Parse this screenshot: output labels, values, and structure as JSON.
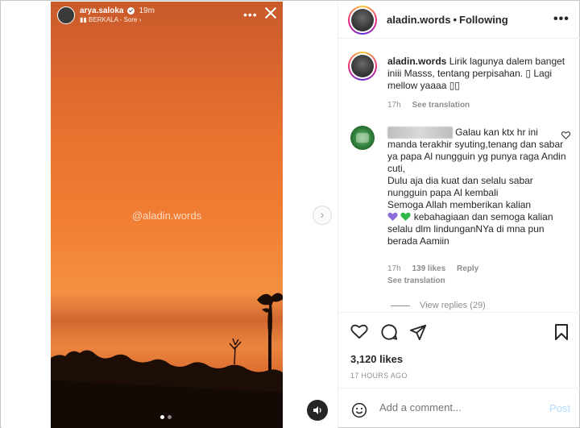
{
  "story": {
    "username": "arya.saloka",
    "time": "19m",
    "music": "BERKALA - Sore",
    "watermark": "@aladin.words",
    "more_glyph": "•••"
  },
  "post": {
    "author": "aladin.words",
    "following": "Following",
    "caption_user": "aladin.words",
    "caption_text": "Lirik lagunya dalem banget iniii Masss, tentang perpisahan. ▯ Lagi mellow yaaaa ▯▯",
    "caption_time": "17h",
    "caption_translation": "See translation",
    "comment": {
      "user": "sebahatter055",
      "text_1": "Galau kan ktx hr ini manda terakhir syuting,tenang dan sabar ya papa Al nungguin yg punya raga Andin cuti,",
      "text_2": "Dulu aja dia kuat dan selalu sabar nungguin papa Al kembali",
      "text_3a": "Semoga Allah memberikan kalian",
      "text_3b": "kebahagiaan dan semoga kalian selalu dlm lindunganNYa di mna pun berada Aamiin",
      "time": "17h",
      "likes": "139 likes",
      "reply": "Reply",
      "translation": "See translation",
      "view_replies": "View replies (29)"
    },
    "likes": "3,120 likes",
    "ago": "17 HOURS AGO",
    "add_comment_placeholder": "Add a comment...",
    "post_label": "Post"
  },
  "colors": {
    "link_blue_disabled": "#b3dbff",
    "heart_purple": "#8b6bd9",
    "heart_green": "#2fb84a"
  }
}
